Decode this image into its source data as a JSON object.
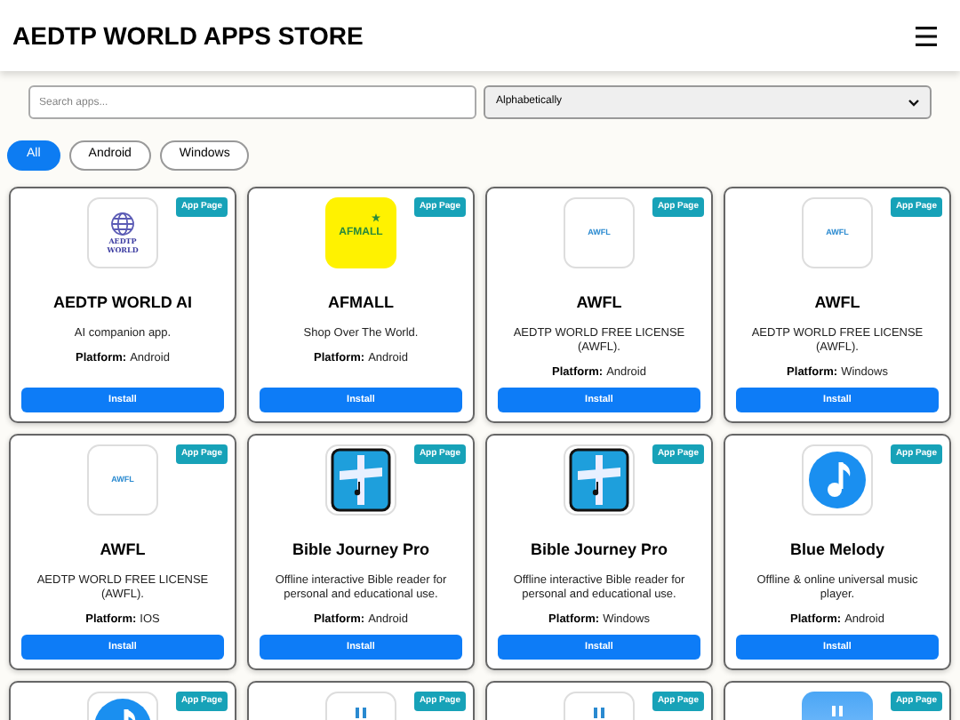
{
  "header": {
    "title": "AEDTP WORLD APPS STORE"
  },
  "search": {
    "placeholder": "Search apps..."
  },
  "sort": {
    "value": "Alphabetically"
  },
  "filters": [
    {
      "label": "All",
      "selected": true
    },
    {
      "label": "Android",
      "selected": false
    },
    {
      "label": "Windows",
      "selected": false
    }
  ],
  "apps": [
    {
      "kind": "globe",
      "logo_text": "AEDTP WORLD",
      "badge": "App Page",
      "name": "AEDTP WORLD AI",
      "description": "AI companion app.",
      "platform_label": "Platform:",
      "platform": "Android",
      "button": "Install"
    },
    {
      "kind": "yellow",
      "logo_text": "AFMALL",
      "badge": "App Page",
      "name": "AFMALL",
      "description": "Shop Over The World.",
      "platform_label": "Platform:",
      "platform": "Android",
      "button": "Install"
    },
    {
      "kind": "wordmark",
      "logo_text": "AWFL",
      "badge": "App Page",
      "name": "AWFL",
      "description": "AEDTP WORLD FREE LICENSE (AWFL).",
      "platform_label": "Platform:",
      "platform": "Android",
      "button": "Install"
    },
    {
      "kind": "wordmark",
      "logo_text": "AWFL",
      "badge": "App Page",
      "name": "AWFL",
      "description": "AEDTP WORLD FREE LICENSE (AWFL).",
      "platform_label": "Platform:",
      "platform": "Windows",
      "button": "Install"
    },
    {
      "kind": "wordmark",
      "logo_text": "AWFL",
      "badge": "App Page",
      "name": "AWFL",
      "description": "AEDTP WORLD FREE LICENSE (AWFL).",
      "platform_label": "Platform:",
      "platform": "IOS",
      "button": "Install"
    },
    {
      "kind": "cross",
      "badge": "App Page",
      "name": "Bible Journey Pro",
      "description": "Offline interactive Bible reader for personal and educational use.",
      "platform_label": "Platform:",
      "platform": "Android",
      "button": "Install"
    },
    {
      "kind": "cross",
      "badge": "App Page",
      "name": "Bible Journey Pro",
      "description": "Offline interactive Bible reader for personal and educational use.",
      "platform_label": "Platform:",
      "platform": "Windows",
      "button": "Install"
    },
    {
      "kind": "note",
      "badge": "App Page",
      "name": "Blue Melody",
      "description": "Offline & online universal music player.",
      "platform_label": "Platform:",
      "platform": "Android",
      "button": "Install"
    },
    {
      "kind": "note",
      "badge": "App Page"
    },
    {
      "kind": "mark",
      "badge": "App Page"
    },
    {
      "kind": "mark",
      "badge": "App Page"
    },
    {
      "kind": "gradient",
      "badge": "App Page"
    }
  ]
}
